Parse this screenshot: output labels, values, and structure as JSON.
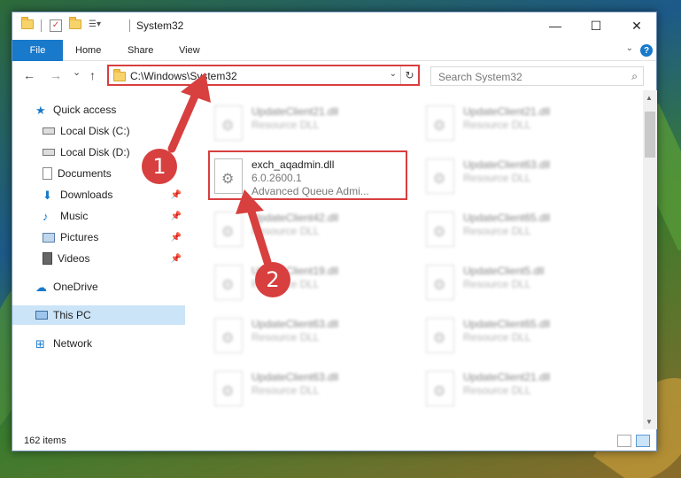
{
  "window": {
    "title": "System32",
    "minimize_glyph": "—",
    "maximize_glyph": "☐",
    "close_glyph": "✕"
  },
  "ribbon": {
    "tabs": [
      "File",
      "Home",
      "Share",
      "View"
    ],
    "help_glyph": "?"
  },
  "address": {
    "path": "C:\\Windows\\System32",
    "refresh_glyph": "↻",
    "dropdown_glyph": "⌄"
  },
  "search": {
    "placeholder": "Search System32",
    "icon": "⌕"
  },
  "nav": {
    "back_glyph": "←",
    "forward_glyph": "→",
    "recent_glyph": "⌄",
    "up_glyph": "↑",
    "items": [
      {
        "label": "Quick access",
        "icon": "star-icon",
        "pinned": false
      },
      {
        "label": "Local Disk (C:)",
        "icon": "drive-icon",
        "pinned": false
      },
      {
        "label": "Local Disk (D:)",
        "icon": "drive-icon",
        "pinned": false
      },
      {
        "label": "Documents",
        "icon": "documents-icon",
        "pinned": false
      },
      {
        "label": "Downloads",
        "icon": "download-icon",
        "pinned": true
      },
      {
        "label": "Music",
        "icon": "music-icon",
        "pinned": true
      },
      {
        "label": "Pictures",
        "icon": "pictures-icon",
        "pinned": true
      },
      {
        "label": "Videos",
        "icon": "videos-icon",
        "pinned": true
      },
      {
        "label": "OneDrive",
        "icon": "cloud-icon",
        "pinned": false
      },
      {
        "label": "This PC",
        "icon": "computer-icon",
        "pinned": false,
        "selected": true
      },
      {
        "label": "Network",
        "icon": "network-icon",
        "pinned": false
      }
    ],
    "pin_glyph": "📌"
  },
  "files": {
    "highlighted": {
      "name": "exch_aqadmin.dll",
      "version": "6.0.2600.1",
      "description": "Advanced Queue Admi..."
    },
    "left_column": [
      {
        "name": "UpdateClient21.dll",
        "type": "Resource DLL"
      },
      {
        "name": "UpdateClient42.dll",
        "type": "Resource DLL"
      },
      {
        "name": "UpdateClient19.dll",
        "type": "Resource DLL"
      },
      {
        "name": "UpdateClient63.dll",
        "type": "Resource DLL"
      },
      {
        "name": "UpdateClient63.dll",
        "type": "Resource DLL"
      }
    ],
    "right_column": [
      {
        "name": "UpdateClient21.dll",
        "type": "Resource DLL"
      },
      {
        "name": "UpdateClient63.dll",
        "type": "Resource DLL"
      },
      {
        "name": "UpdateClient65.dll",
        "type": "Resource DLL"
      },
      {
        "name": "UpdateClient5.dll",
        "type": "Resource DLL"
      },
      {
        "name": "UpdateClient65.dll",
        "type": "Resource DLL"
      },
      {
        "name": "UpdateClient21.dll",
        "type": "Resource DLL"
      }
    ]
  },
  "status": {
    "item_count": "162 items"
  },
  "annotations": {
    "marker_1": "1",
    "marker_2": "2",
    "color": "#d83f3f"
  }
}
